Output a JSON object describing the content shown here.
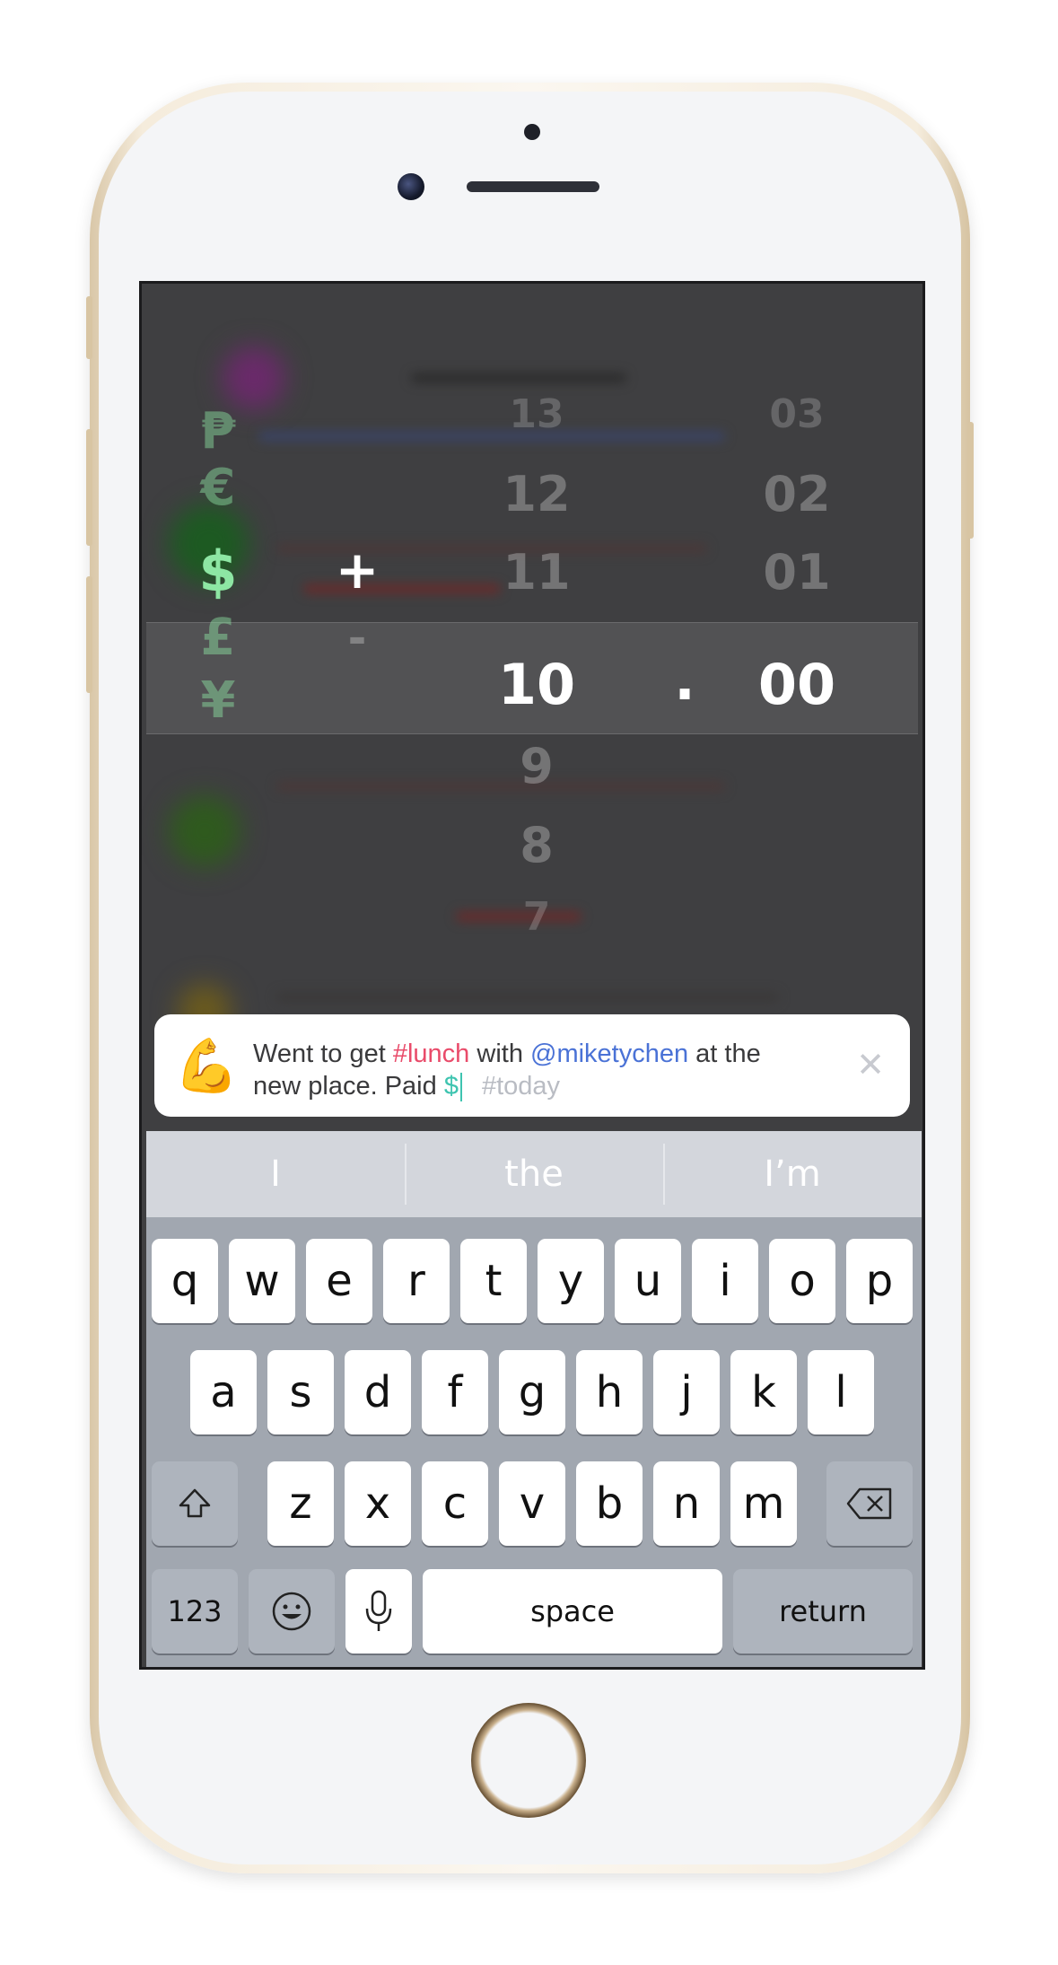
{
  "picker": {
    "currency_above": [
      "₱",
      "€"
    ],
    "currency_selected": "$",
    "currency_below": [
      "£",
      "¥"
    ],
    "sign_selected": "+",
    "sign_below": "-",
    "integer_above": [
      "13",
      "12",
      "11"
    ],
    "integer_selected": "10",
    "integer_below": [
      "9",
      "8",
      "7"
    ],
    "decimal_point": ".",
    "fraction_above": [
      "03",
      "02",
      "01"
    ],
    "fraction_selected": "00"
  },
  "entry": {
    "emoji": "💪",
    "text_1": "Went to get ",
    "hashtag": "#lunch",
    "text_2": " with ",
    "mention": "@miketychen",
    "text_3": " at the",
    "text_4": "new place. Paid ",
    "currency_token": "$",
    "tag_placeholder": "#today",
    "close_glyph": "✕"
  },
  "keyboard": {
    "suggestions": [
      "I",
      "the",
      "I’m"
    ],
    "row1": [
      "q",
      "w",
      "e",
      "r",
      "t",
      "y",
      "u",
      "i",
      "o",
      "p"
    ],
    "row2": [
      "a",
      "s",
      "d",
      "f",
      "g",
      "h",
      "j",
      "k",
      "l"
    ],
    "row3": [
      "z",
      "x",
      "c",
      "v",
      "b",
      "n",
      "m"
    ],
    "numbers_label": "123",
    "space_label": "space",
    "return_label": "return"
  },
  "colors": {
    "hashtag": "#e94b6a",
    "mention": "#4a72d6",
    "currency_token": "#3ec4b0",
    "currency_selected": "#8de6a3",
    "placeholder": "#b9bcc3"
  }
}
